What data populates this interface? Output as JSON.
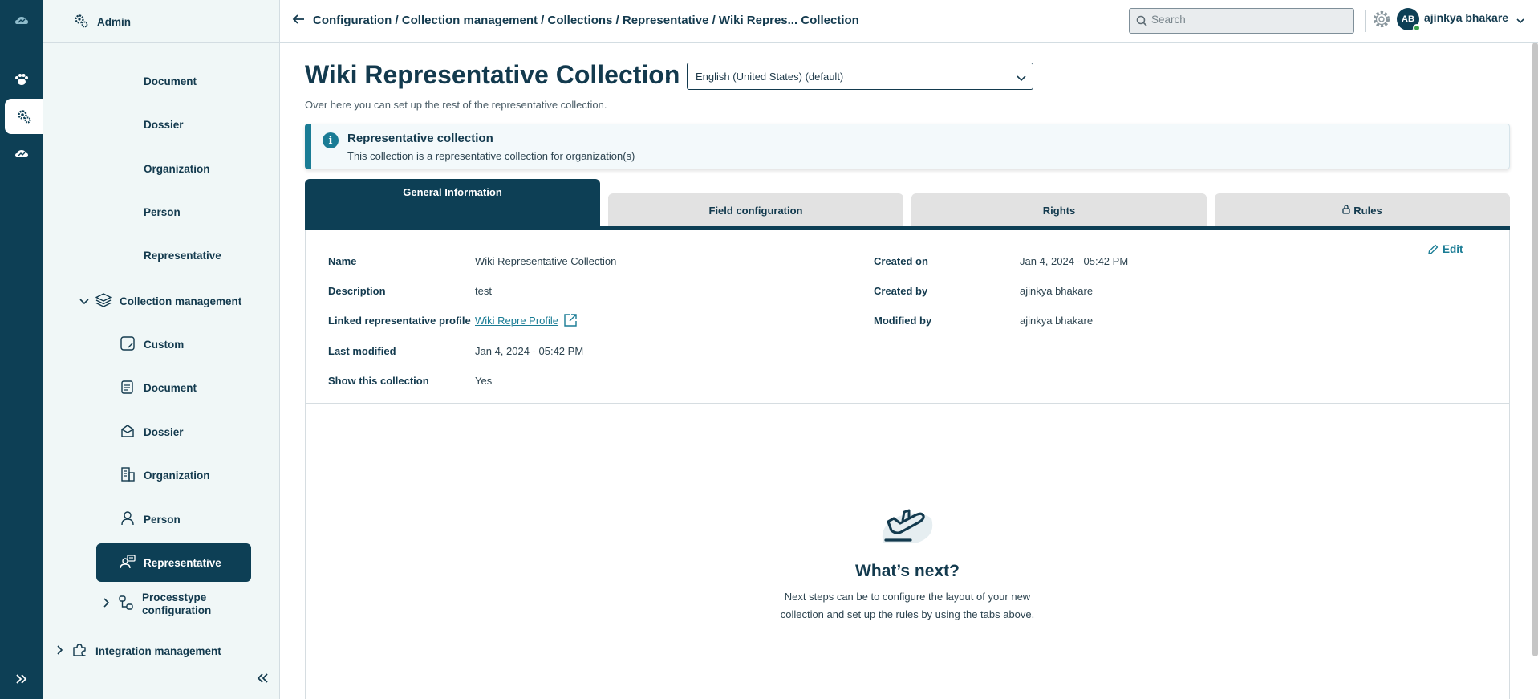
{
  "sidebar": {
    "admin_label": "Admin",
    "sub_items_top": [
      "Document",
      "Dossier",
      "Organization",
      "Person",
      "Representative"
    ],
    "collection_management": "Collection management",
    "items": {
      "custom": "Custom",
      "document": "Document",
      "dossier": "Dossier",
      "organization": "Organization",
      "person": "Person",
      "representative": "Representative",
      "processtype_line1": "Processtype",
      "processtype_line2": "configuration"
    },
    "integration_management": "Integration management"
  },
  "header": {
    "breadcrumb": "Configuration / Collection management / Collections / Representative / Wiki Repres... Collection",
    "search_placeholder": "Search",
    "user_initials": "AB",
    "user_name": "ajinkya bhakare"
  },
  "page": {
    "title": "Wiki Representative Collection",
    "language": "English (United States) (default)",
    "subtitle": "Over here you can set up the rest of the representative collection."
  },
  "info": {
    "title": "Representative collection",
    "text": "This collection is a representative collection for organization(s)"
  },
  "tabs": {
    "general": "General Information",
    "fields": "Field configuration",
    "rights": "Rights",
    "rules": "Rules"
  },
  "details": {
    "name_label": "Name",
    "name_value": "Wiki Representative Collection",
    "description_label": "Description",
    "description_value": "test",
    "linked_label": "Linked representative profile",
    "linked_value": "Wiki Repre Profile",
    "modified_label": "Last modified",
    "modified_value": "Jan 4, 2024 - 05:42 PM",
    "show_label": "Show this collection",
    "show_value": "Yes",
    "created_on_label": "Created on",
    "created_on_value": "Jan 4, 2024 - 05:42 PM",
    "created_by_label": "Created by",
    "created_by_value": "ajinkya bhakare",
    "modified_by_label": "Modified by",
    "modified_by_value": "ajinkya bhakare",
    "edit_label": "Edit"
  },
  "next": {
    "title": "What’s next?",
    "line1": "Next steps can be to configure the layout of your new",
    "line2": "collection and set up the rules by using the tabs above."
  },
  "colors": {
    "primary": "#0d3f55",
    "accent": "#1a7c95",
    "sidebar_bg": "#f0f7f7"
  }
}
